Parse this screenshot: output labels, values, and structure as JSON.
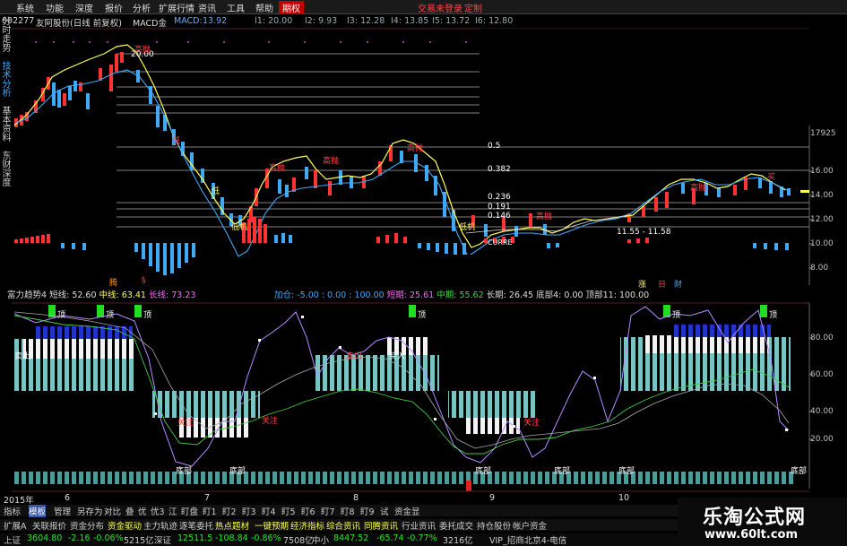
{
  "colors": {
    "up": "#ff3333",
    "down": "#3fa9f5",
    "accent": "#ffff55",
    "cyan": "#00ffff",
    "magenta": "#ff66ff",
    "green": "#33dd33",
    "menu_active": "#c00000"
  },
  "menu": {
    "items": [
      "系统",
      "功能",
      "深度",
      "报价",
      "分析",
      "扩展行情",
      "资讯",
      "工具",
      "帮助",
      "期权"
    ],
    "right_1": "交易未登录",
    "right_2": "定制"
  },
  "header": {
    "code": "002277",
    "name": "友阿股份(日线 前复权)",
    "indicator": "MACD金",
    "macd_label": "MACD:",
    "macd_val": "13.92",
    "i1": "I1: 20.00",
    "i2": "I2: 9.93",
    "i3": "I3: 12.28",
    "i4": "I4: 13.85",
    "i5": "I5: 13.72",
    "i6": "I6: 12.80"
  },
  "side_tabs": [
    "分时走势",
    "技术分析",
    "基本资料",
    "东财深度"
  ],
  "price_axis": {
    "top": "17925",
    "ticks": [
      "16.00",
      "14.00",
      "12.00",
      "10.00",
      "8.00"
    ]
  },
  "chart_labels": {
    "start_price": "20.00",
    "low1": "低",
    "low2": "低",
    "low3": "低机",
    "low4": "低机",
    "high1": "高抛",
    "high2": "高抛",
    "high3": "高抛",
    "high4": "高抛",
    "high5": "高抛",
    "high6": "高抛",
    "buy1": "买",
    "range": "11.55 - 11.58",
    "fib_05": "0.5",
    "fib_0382": "0.382",
    "fib_0236": "0.236",
    "fib_0191": "0.191",
    "fib_0146": "0.146",
    "low_price": "CURRE",
    "marker_teng": "腾",
    "marker_s": "§",
    "marker_zhang": "涨",
    "marker_ri": "日",
    "marker_cai": "财"
  },
  "ind_bar": {
    "name": "富力趋势4",
    "short_lbl": "短线:",
    "short_val": "52.60",
    "mid_lbl": "中线:",
    "mid_val": "63.41",
    "long_lbl": "长线:",
    "long_val": "73.23",
    "add_lbl": "加仓:",
    "add_val": "-5.00 : 0.00 : 100.00",
    "cycle_lbl": "短期:",
    "cycle_val": "25.61",
    "mid2_lbl": "中期:",
    "mid2_val": "55.62",
    "long2_lbl": "长期:",
    "long2_val": "26.45",
    "bottom_lbl": "底部4:",
    "bottom_val": "0.00",
    "top_lbl": "顶部11:",
    "top_val": "100.00"
  },
  "ind_axis": {
    "ticks": [
      "80.00",
      "60.00",
      "40.00",
      "20.00"
    ]
  },
  "ind_labels": {
    "top1": "顶",
    "top2": "顶",
    "top3": "顶",
    "top4": "顶",
    "top5": "顶",
    "top6": "顶",
    "guanzhu1": "关注",
    "guanzhu2": "关注",
    "guanzhu3": "关注",
    "bottom": "底部",
    "sell1": "卖出",
    "sell2": "卖出",
    "buy": "买入"
  },
  "date_axis": {
    "year": "2015年",
    "m6": "6",
    "m7": "7",
    "m8": "8",
    "m9": "9",
    "m10": "10"
  },
  "bottom_tabs": [
    "指标",
    "模板",
    "管理",
    "另存为",
    "对比",
    "叠",
    "优",
    "优3",
    "江",
    "盯盘",
    "盯1",
    "盯2",
    "盯3",
    "盯4",
    "盯5",
    "盯6",
    "盯7",
    "盯8",
    "盯9",
    "试",
    "资金显"
  ],
  "bottom_tabs2": [
    "扩展A",
    "关联报价",
    "资金分布",
    "资金驱动",
    "主力轨迹",
    "逐笔委托",
    "热点题材",
    "一键预期",
    "经济指标",
    "综合资讯",
    "同腾资讯",
    "行业资讯",
    "委托成交",
    "持仓股份",
    "帐户资金"
  ],
  "status": {
    "sh_lbl": "上证",
    "sh_val": "3604.80",
    "sh_chg": "-2.16",
    "sh_pct": "-0.06%",
    "sh_amt": "5215亿",
    "sz_lbl": "深证",
    "sz_val": "12511.5",
    "sz_chg": "-108.84",
    "sz_pct": "-0.86%",
    "sz_amt": "7508亿",
    "zx_lbl": "中小",
    "zx_val": "8447.52",
    "zx_chg": "-65.74",
    "zx_pct": "-0.77%",
    "zx_amt": "3216亿",
    "vip": "VIP_招商北京4-电信"
  },
  "watermark": {
    "title": "乐淘公式网",
    "url": "www.60lt.com"
  }
}
